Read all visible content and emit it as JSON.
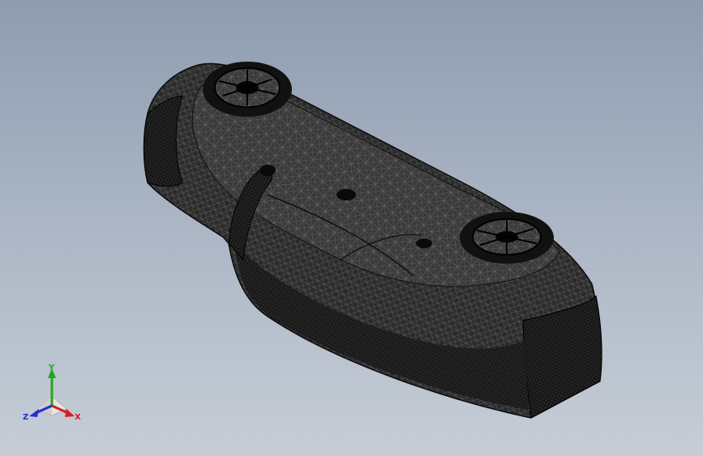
{
  "viewport": {
    "background_top": "#8e9cb0",
    "background_bottom": "#c6cdd7",
    "model_render_mode": "wireframe-mesh",
    "model_color": "#1a1a1a"
  },
  "triad": {
    "x_label": "X",
    "y_label": "Y",
    "z_label": "Z",
    "x_color": "#d42020",
    "y_color": "#1fa81f",
    "z_color": "#2030d0"
  }
}
